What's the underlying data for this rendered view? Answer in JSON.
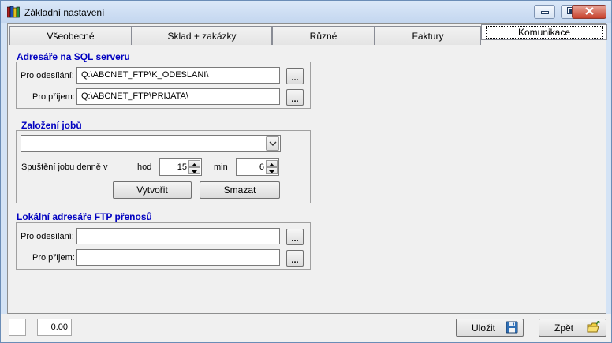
{
  "window": {
    "title": "Základní nastavení",
    "icons": {
      "app": "books-icon",
      "minimize": "minimize-icon",
      "maximize": "maximize-icon",
      "close": "close-icon"
    }
  },
  "tabs": [
    {
      "label": "Všeobecné",
      "active": false
    },
    {
      "label": "Sklad + zakázky",
      "active": false
    },
    {
      "label": "Různé",
      "active": false
    },
    {
      "label": "Faktury",
      "active": false
    },
    {
      "label": "Komunikace",
      "active": true
    }
  ],
  "sql_dirs": {
    "title": "Adresáře na SQL serveru",
    "send_label": "Pro odesílání:",
    "send_value": "Q:\\ABCNET_FTP\\K_ODESLANI\\",
    "receive_label": "Pro příjem:",
    "receive_value": "Q:\\ABCNET_FTP\\PRIJATA\\",
    "browse_label": "..."
  },
  "jobs": {
    "title": "Založení jobů",
    "combo_value": "",
    "run_label": "Spuštění jobu denně v",
    "hour_label": "hod",
    "hour_value": "15",
    "minute_label": "min",
    "minute_value": "6",
    "create_label": "Vytvořit",
    "delete_label": "Smazat"
  },
  "ftp_dirs": {
    "title": "Lokální adresáře FTP přenosů",
    "send_label": "Pro odesílání:",
    "send_value": "",
    "receive_label": "Pro příjem:",
    "receive_value": "",
    "browse_label": "..."
  },
  "status": {
    "amount": "0.00",
    "save_label": "Uložit",
    "back_label": "Zpět",
    "save_icon": "floppy-disk-icon",
    "back_icon": "folder-exit-icon"
  }
}
